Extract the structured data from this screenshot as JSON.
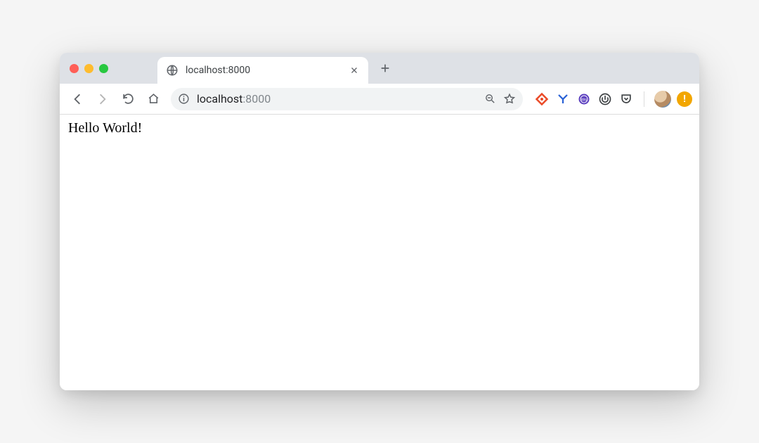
{
  "tab": {
    "title": "localhost:8000"
  },
  "omnibox": {
    "url_host": "localhost",
    "url_port": ":8000"
  },
  "page": {
    "body_text": "Hello World!"
  },
  "alert_badge": "!"
}
